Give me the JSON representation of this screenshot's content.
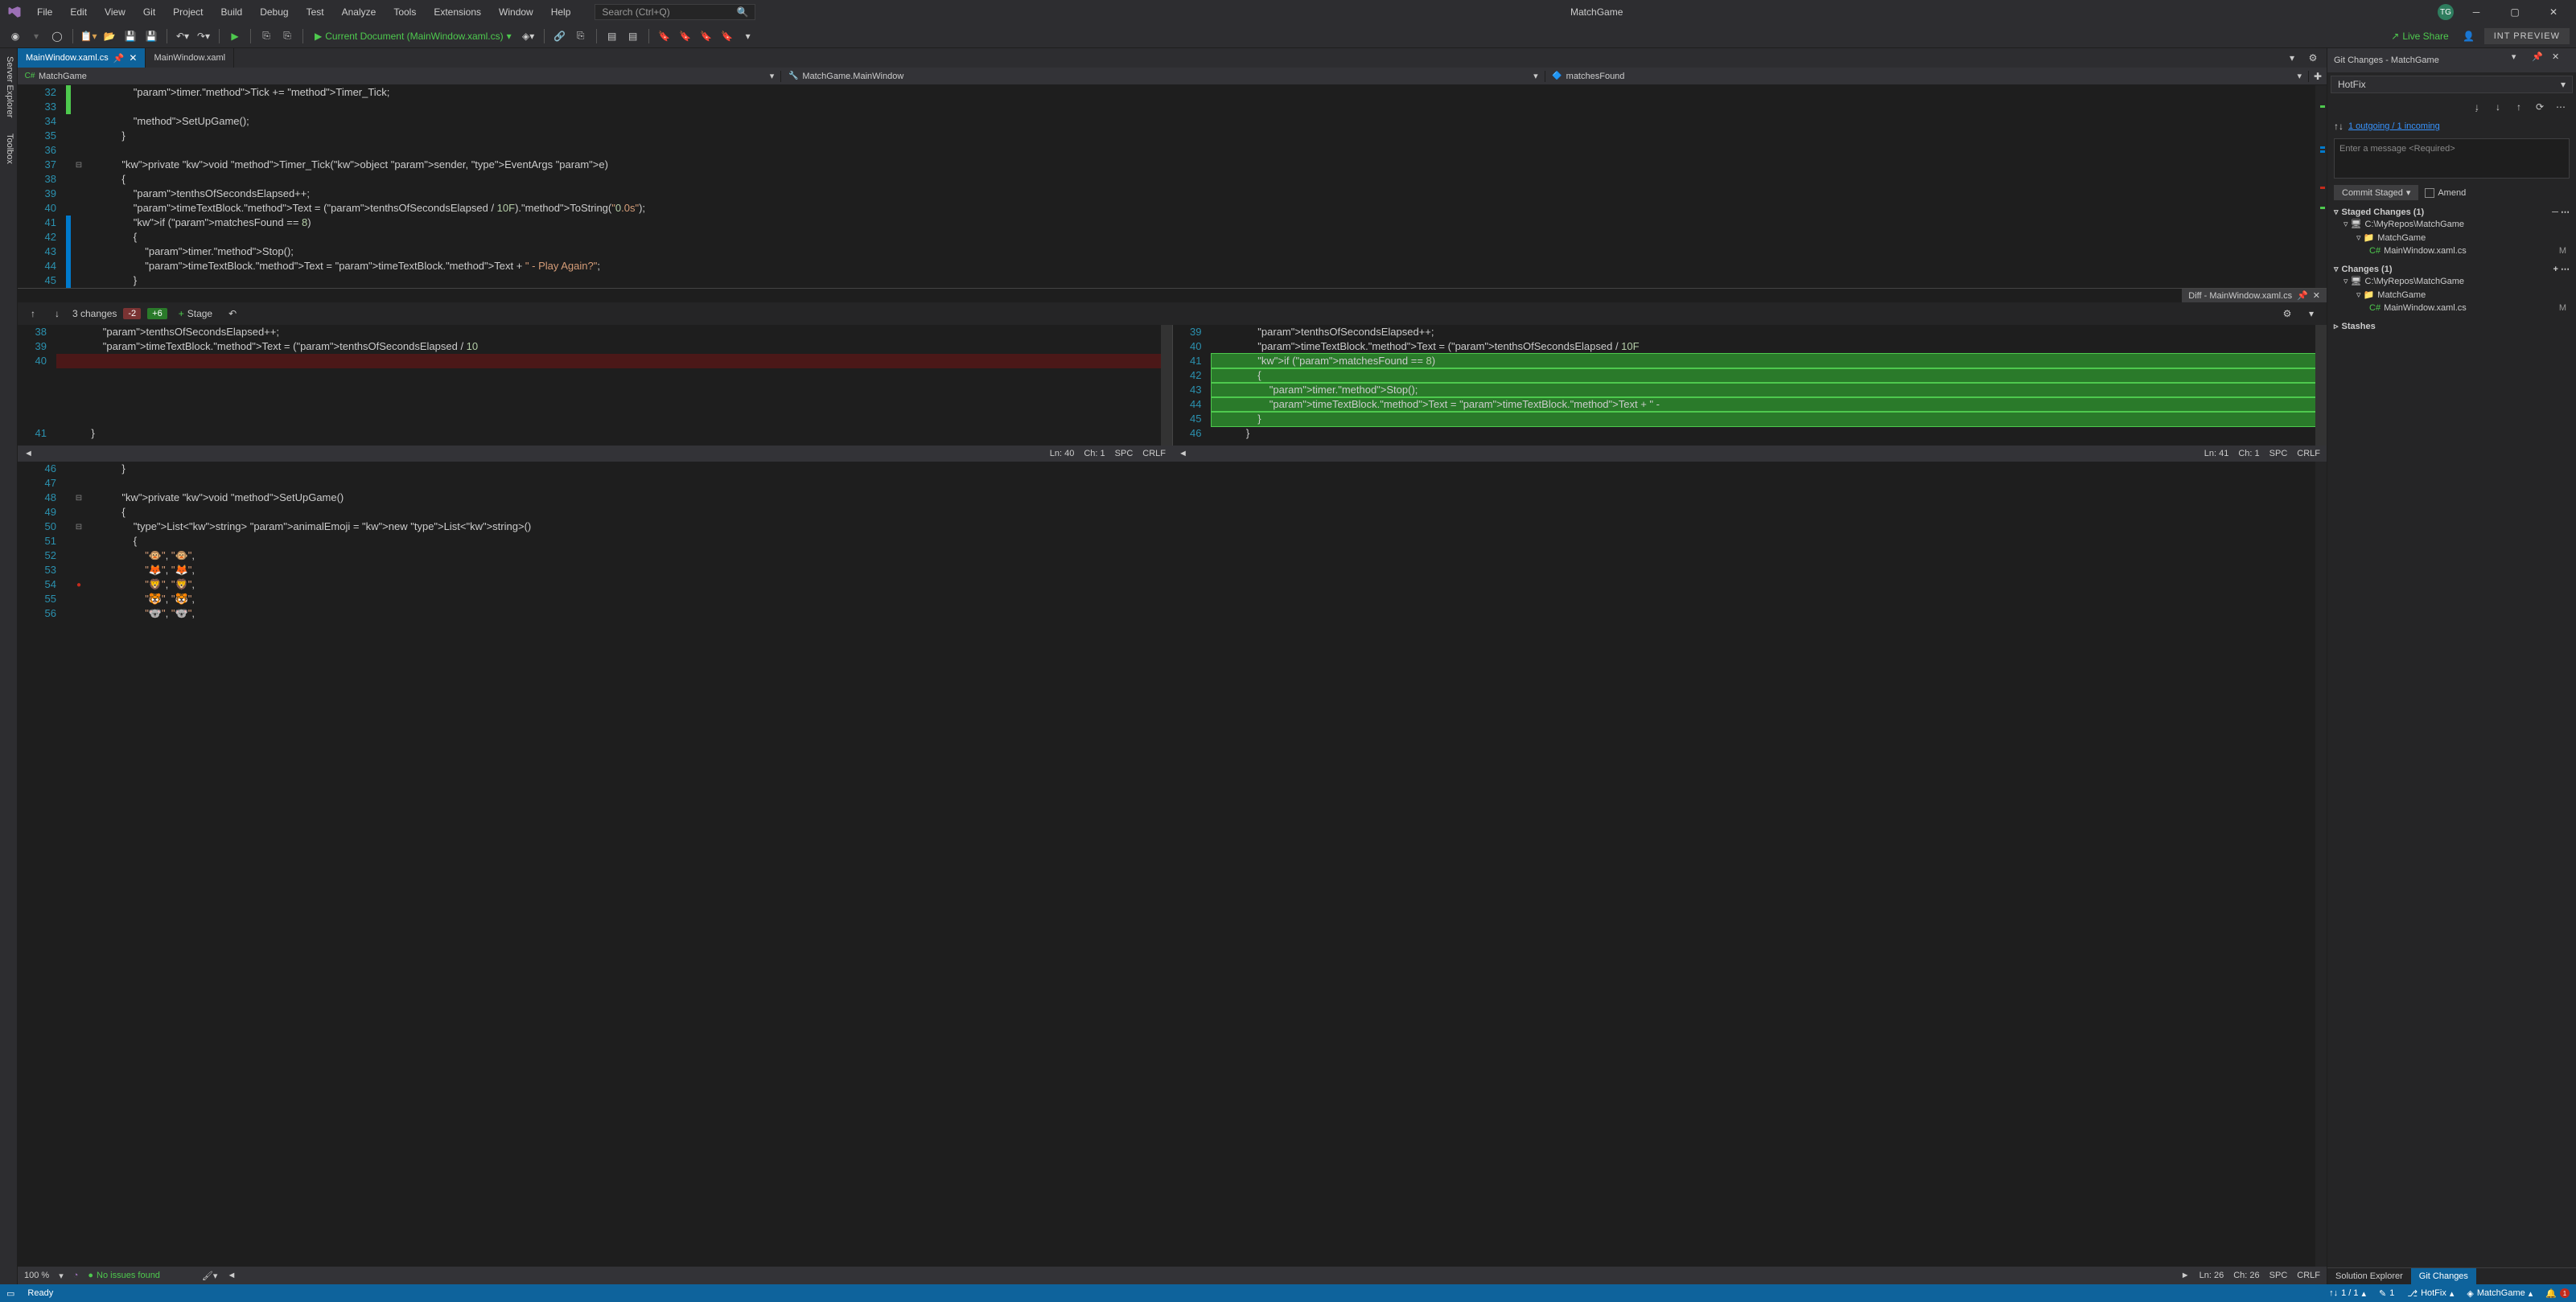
{
  "titlebar": {
    "menus": [
      "File",
      "Edit",
      "View",
      "Git",
      "Project",
      "Build",
      "Debug",
      "Test",
      "Analyze",
      "Tools",
      "Extensions",
      "Window",
      "Help"
    ],
    "search_placeholder": "Search (Ctrl+Q)",
    "app_title": "MatchGame",
    "avatar_initials": "TG"
  },
  "toolbar": {
    "current_doc": "Current Document (MainWindow.xaml.cs)",
    "live_share": "Live Share",
    "int_preview": "INT PREVIEW"
  },
  "side_tabs": [
    "Server Explorer",
    "Toolbox"
  ],
  "doc_tabs": {
    "active": "MainWindow.xaml.cs",
    "inactive": "MainWindow.xaml"
  },
  "nav": {
    "namespace": "MatchGame",
    "class": "MatchGame.MainWindow",
    "member": "matchesFound"
  },
  "code_top": {
    "lines": [
      {
        "n": 32,
        "t": "                timer.Tick += Timer_Tick;",
        "c": "green"
      },
      {
        "n": 33,
        "t": "",
        "c": "green"
      },
      {
        "n": 34,
        "t": "                SetUpGame();"
      },
      {
        "n": 35,
        "t": "            }"
      },
      {
        "n": 36,
        "t": ""
      },
      {
        "n": 37,
        "t": "            private void Timer_Tick(object sender, EventArgs e)",
        "fold": true
      },
      {
        "n": 38,
        "t": "            {"
      },
      {
        "n": 39,
        "t": "                tenthsOfSecondsElapsed++;"
      },
      {
        "n": 40,
        "t": "                timeTextBlock.Text = (tenthsOfSecondsElapsed / 10F).ToString(\"0.0s\");"
      },
      {
        "n": 41,
        "t": "                if (matchesFound == 8)",
        "c": "blue"
      },
      {
        "n": 42,
        "t": "                {",
        "c": "blue"
      },
      {
        "n": 43,
        "t": "                    timer.Stop();",
        "c": "blue"
      },
      {
        "n": 44,
        "t": "                    timeTextBlock.Text = timeTextBlock.Text + \" - Play Again?\";",
        "c": "blue"
      },
      {
        "n": 45,
        "t": "                }",
        "c": "blue"
      }
    ]
  },
  "diff": {
    "title": "Diff - MainWindow.xaml.cs",
    "changes": "3 changes",
    "minus": "-2",
    "plus": "+6",
    "stage": "Stage",
    "left_lines": [
      {
        "n": 38,
        "t": "                tenthsOfSecondsElapsed++;"
      },
      {
        "n": 39,
        "t": "                timeTextBlock.Text = (tenthsOfSecondsElapsed / 10"
      },
      {
        "n": 40,
        "t": "",
        "removed": true
      },
      {
        "n": "",
        "t": ""
      },
      {
        "n": "",
        "t": ""
      },
      {
        "n": "",
        "t": ""
      },
      {
        "n": "",
        "t": ""
      },
      {
        "n": 41,
        "t": "            }"
      }
    ],
    "right_lines": [
      {
        "n": 39,
        "t": "                tenthsOfSecondsElapsed++;"
      },
      {
        "n": 40,
        "t": "                timeTextBlock.Text = (tenthsOfSecondsElapsed / 10F"
      },
      {
        "n": 41,
        "t": "                if (matchesFound == 8)",
        "added": true
      },
      {
        "n": 42,
        "t": "                {",
        "added": true
      },
      {
        "n": 43,
        "t": "                    timer.Stop();",
        "added": true
      },
      {
        "n": 44,
        "t": "                    timeTextBlock.Text = timeTextBlock.Text + \" - ",
        "added": true
      },
      {
        "n": 45,
        "t": "                }",
        "added": true
      },
      {
        "n": 46,
        "t": "            }"
      }
    ],
    "status_left": {
      "ln": "Ln: 40",
      "ch": "Ch: 1",
      "spc": "SPC",
      "crlf": "CRLF"
    },
    "status_right": {
      "ln": "Ln: 41",
      "ch": "Ch: 1",
      "spc": "SPC",
      "crlf": "CRLF"
    }
  },
  "code_bottom": {
    "lines": [
      {
        "n": 46,
        "t": "            }"
      },
      {
        "n": 47,
        "t": ""
      },
      {
        "n": 48,
        "t": "            private void SetUpGame()",
        "fold": true
      },
      {
        "n": 49,
        "t": "            {"
      },
      {
        "n": 50,
        "t": "                List<string> animalEmoji = new List<string>()",
        "fold": true
      },
      {
        "n": 51,
        "t": "                {"
      },
      {
        "n": 52,
        "t": "                    \"🐵\", \"🐵\","
      },
      {
        "n": 53,
        "t": "                    \"🦊\", \"🦊\","
      },
      {
        "n": 54,
        "t": "                    \"🦁\", \"🦁\",",
        "bp": true
      },
      {
        "n": 55,
        "t": "                    \"🐯\", \"🐯\","
      },
      {
        "n": 56,
        "t": "                    \"🐨\", \"🐨\","
      }
    ]
  },
  "editor_status": {
    "zoom": "100 %",
    "no_issues": "No issues found",
    "ln": "Ln: 26",
    "ch": "Ch: 26",
    "spc": "SPC",
    "crlf": "CRLF"
  },
  "git": {
    "title": "Git Changes - MatchGame",
    "branch": "HotFix",
    "sync_text": "1 outgoing / 1 incoming",
    "msg_placeholder": "Enter a message <Required>",
    "commit_btn": "Commit Staged",
    "amend": "Amend",
    "staged_hdr": "Staged Changes (1)",
    "changes_hdr": "Changes (1)",
    "stashes_hdr": "Stashes",
    "repo_path": "C:\\MyRepos\\MatchGame",
    "project": "MatchGame",
    "file": "MainWindow.xaml.cs",
    "file_status": "M",
    "footer_tabs": {
      "solution_explorer": "Solution Explorer",
      "git_changes": "Git Changes"
    }
  },
  "statusbar": {
    "ready": "Ready",
    "sync": "1 / 1",
    "pencil": "1",
    "branch": "HotFix",
    "repo": "MatchGame",
    "bell": "1"
  }
}
